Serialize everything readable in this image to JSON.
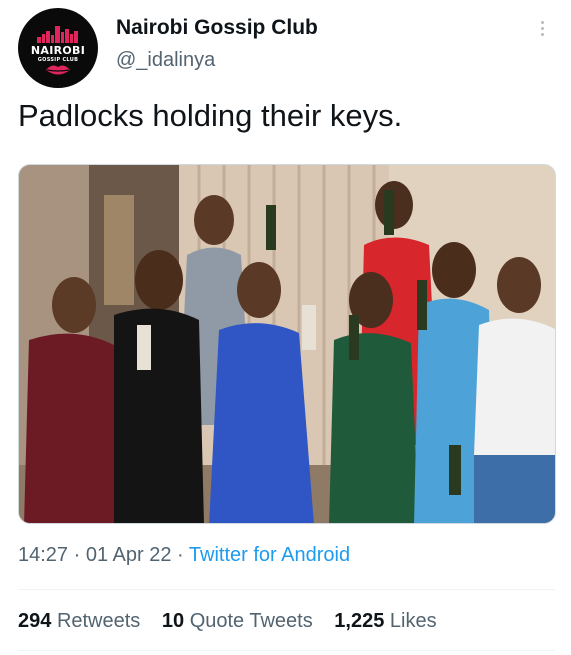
{
  "author": {
    "display_name": "Nairobi Gossip Club",
    "handle": "@_idalinya",
    "avatar_logo_text": "NAIROBI",
    "avatar_logo_subtext": "GOSSIP CLUB"
  },
  "tweet": {
    "text": "Padlocks holding their keys."
  },
  "meta": {
    "time": "14:27",
    "separator1": " · ",
    "date": "01 Apr 22",
    "separator2": " · ",
    "source": "Twitter for Android"
  },
  "stats": {
    "retweets_count": "294",
    "retweets_label": "Retweets",
    "quotes_count": "10",
    "quotes_label": "Quote Tweets",
    "likes_count": "1,225",
    "likes_label": "Likes"
  },
  "colors": {
    "link": "#1d9bf0",
    "secondary_text": "#536471",
    "avatar_accent": "#e0245e"
  }
}
